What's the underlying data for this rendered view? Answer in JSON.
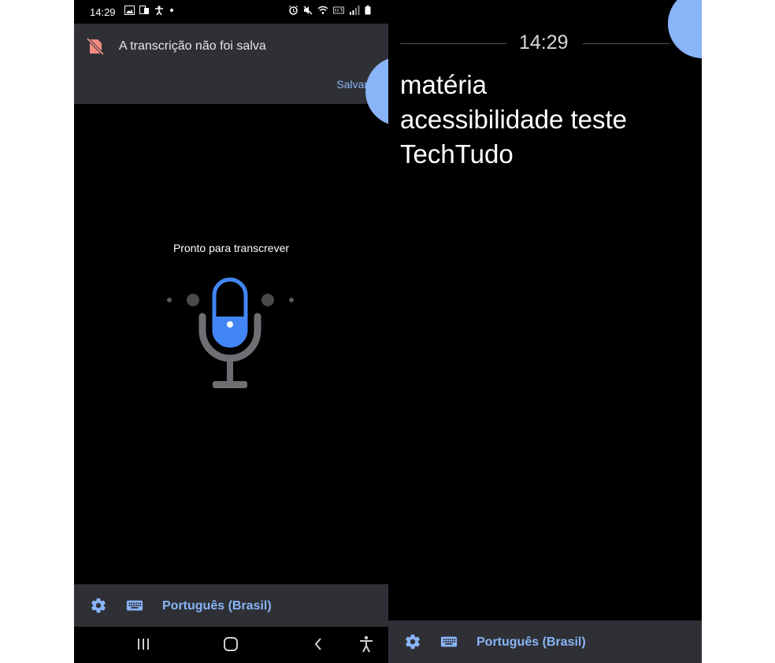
{
  "status_bar": {
    "time": "14:29"
  },
  "banner": {
    "message": "A transcrição não foi salva",
    "save_label": "Salvar"
  },
  "main": {
    "ready_label": "Pronto para transcrever"
  },
  "bottom_bar": {
    "language": "Português (Brasil)"
  },
  "right_screen": {
    "clock": "14:29",
    "transcript": "matéria\nacessibilidade teste\nTechTudo"
  },
  "icons": {
    "banner": "no-save-icon",
    "settings": "gear-icon",
    "keyboard": "keyboard-icon",
    "nav": [
      "recent-apps-icon",
      "home-icon",
      "back-icon",
      "accessibility-icon"
    ]
  },
  "colors": {
    "accent": "#8ab4f8",
    "mic_blue": "#4285f4",
    "surface": "#2e3035",
    "background": "#000000",
    "warning": "#f28b82"
  }
}
